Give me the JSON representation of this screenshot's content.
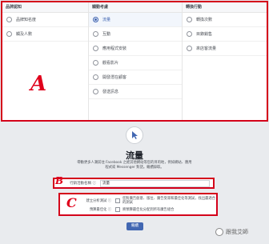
{
  "columns": [
    {
      "title": "品牌認知",
      "options": [
        {
          "label": "品牌知名度",
          "selected": false
        },
        {
          "label": "觸及人數",
          "selected": false
        }
      ]
    },
    {
      "title": "觸動考慮",
      "options": [
        {
          "label": "流量",
          "selected": true
        },
        {
          "label": "互動",
          "selected": false
        },
        {
          "label": "應用程式安裝",
          "selected": false
        },
        {
          "label": "觀看影片",
          "selected": false
        },
        {
          "label": "開發潛在顧客",
          "selected": false
        },
        {
          "label": "發送訊息",
          "selected": false
        }
      ]
    },
    {
      "title": "轉換行動",
      "options": [
        {
          "label": "轉換次數",
          "selected": false
        },
        {
          "label": "目錄銷售",
          "selected": false
        },
        {
          "label": "來店客流量",
          "selected": false
        }
      ]
    }
  ],
  "annotations": {
    "a": "A",
    "b": "B",
    "c": "C"
  },
  "detail": {
    "title": "流量",
    "description": "帶動更多人潮前往 Facebook 之經其他網站等您的目的地，例如網站、應用程式或 Messenger 對話。繼續錄取。",
    "campaign_name_label": "行銷活動名稱 ⓘ",
    "campaign_name_value": "流量",
    "split_test_label": "建立分析測試 ⓘ",
    "split_test_text": "您對廣告創意、版位、廣告受眾和最佳化等測試，找出最適合的測試",
    "budget_opt_label": "預算最佳化 ⓘ",
    "budget_opt_text": "將預算最佳化分配到所有廣告組合",
    "next_button": "繼續"
  },
  "watermark": "跟我艾師"
}
